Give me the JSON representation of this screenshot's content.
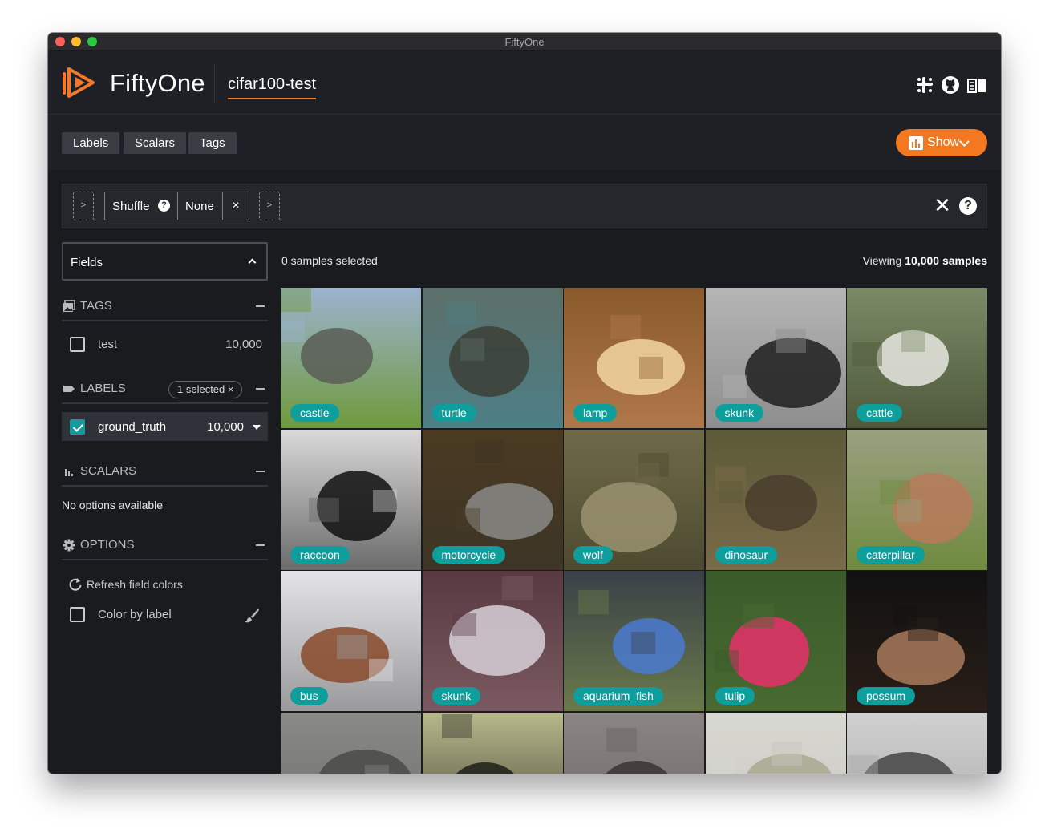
{
  "window": {
    "title": "FiftyOne"
  },
  "header": {
    "brand": "FiftyOne",
    "dataset": "cifar100-test",
    "icons": [
      "slack-icon",
      "github-icon",
      "docs-book-icon"
    ]
  },
  "toolbar": {
    "tabs": [
      "Labels",
      "Scalars",
      "Tags"
    ],
    "show_label": "Show"
  },
  "view_bar": {
    "stage_name": "Shuffle",
    "stage_param": "None",
    "remove_stage": "×",
    "clear": "✕",
    "help": "?"
  },
  "sidebar": {
    "fields_title": "Fields",
    "tags": {
      "title": "TAGS",
      "items": [
        {
          "name": "test",
          "count": "10,000",
          "checked": false
        }
      ]
    },
    "labels": {
      "title": "LABELS",
      "selected_pill": "1 selected ×",
      "items": [
        {
          "name": "ground_truth",
          "count": "10,000",
          "checked": true
        }
      ]
    },
    "scalars": {
      "title": "SCALARS",
      "empty": "No options available"
    },
    "options": {
      "title": "OPTIONS",
      "refresh": "Refresh field colors",
      "color_by_label": "Color by label"
    }
  },
  "main": {
    "selected_count": "0 samples selected",
    "viewing_prefix": "Viewing ",
    "viewing_count": "10,000 samples"
  },
  "colors": {
    "accent": "#f4781f",
    "label_teal": "#0e9e9b",
    "background": "#191b1f"
  },
  "samples": [
    {
      "label": "castle",
      "sky": "#9bb3cf",
      "ground": "#6f9a3c",
      "obj": "#5a5d57"
    },
    {
      "label": "turtle",
      "sky": "#5c6f69",
      "ground": "#4d7f86",
      "obj": "#3b3f36"
    },
    {
      "label": "lamp",
      "sky": "#8a5a2a",
      "ground": "#b0784a",
      "obj": "#f2d6a0"
    },
    {
      "label": "skunk",
      "sky": "#b5b5b5",
      "ground": "#8e8e8e",
      "obj": "#1e1e1e"
    },
    {
      "label": "cattle",
      "sky": "#7a8a66",
      "ground": "#4f5a3c",
      "obj": "#e8e8e2"
    },
    {
      "label": "raccoon",
      "sky": "#d9d9d9",
      "ground": "#6b6b6b",
      "obj": "#111111"
    },
    {
      "label": "motorcycle",
      "sky": "#4a3a22",
      "ground": "#3d3526",
      "obj": "#8a8a86"
    },
    {
      "label": "wolf",
      "sky": "#6e6a48",
      "ground": "#4e4a30",
      "obj": "#9a9270"
    },
    {
      "label": "dinosaur",
      "sky": "#5c5a38",
      "ground": "#7a6a48",
      "obj": "#4a3e2e"
    },
    {
      "label": "caterpillar",
      "sky": "#9aa080",
      "ground": "#6f8a3e",
      "obj": "#b87a5a"
    },
    {
      "label": "bus",
      "sky": "#e4e4e8",
      "ground": "#9a9a9c",
      "obj": "#8a4a2a"
    },
    {
      "label": "skunk",
      "sky": "#5a3a42",
      "ground": "#7a5a60",
      "obj": "#d8d0d8"
    },
    {
      "label": "aquarium_fish",
      "sky": "#3a4048",
      "ground": "#6a7a4a",
      "obj": "#4a7ad0"
    },
    {
      "label": "tulip",
      "sky": "#3a5a2a",
      "ground": "#4a6a32",
      "obj": "#e8306a"
    },
    {
      "label": "possum",
      "sky": "#111111",
      "ground": "#2a1e18",
      "obj": "#a87a5a"
    },
    {
      "label": "",
      "sky": "#8a8a88",
      "ground": "#6a6a68",
      "obj": "#4a4a48"
    },
    {
      "label": "",
      "sky": "#b8b88a",
      "ground": "#3a3a30",
      "obj": "#1e1e1a"
    },
    {
      "label": "",
      "sky": "#8a8482",
      "ground": "#6a6462",
      "obj": "#3a3432"
    },
    {
      "label": "",
      "sky": "#d8d8d2",
      "ground": "#c8c8c0",
      "obj": "#a8a890"
    },
    {
      "label": "",
      "sky": "#d0d0d0",
      "ground": "#a8a8a8",
      "obj": "#444444"
    }
  ]
}
